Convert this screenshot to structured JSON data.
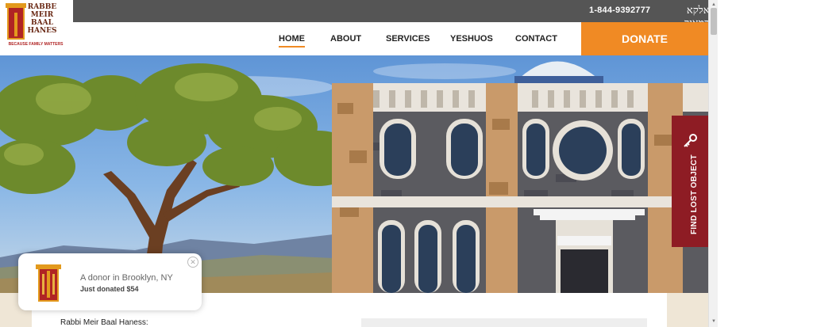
{
  "topbar": {
    "phone": "1-844-9392777",
    "hebrew": "אלקא דמאיר ענני"
  },
  "logo": {
    "lines": [
      "RABBE",
      "MEIR",
      "BAAL",
      "HANES"
    ],
    "tagline": "BECAUSE FAMILY MATTERS"
  },
  "nav": {
    "items": [
      "HOME",
      "ABOUT",
      "SERVICES",
      "YESHUOS",
      "CONTACT"
    ],
    "active": "HOME"
  },
  "donate": {
    "label": "DONATE",
    "color": "#f08a24"
  },
  "lost_tab": {
    "label": "FIND LOST OBJECT",
    "icon": "key-icon",
    "color": "#8e1c24"
  },
  "popup": {
    "text": "A donor in Brooklyn, NY",
    "sub": "Just donated $54",
    "close_icon": "close-icon"
  },
  "content": {
    "heading": "Rabbi Meir Baal Haness:"
  }
}
